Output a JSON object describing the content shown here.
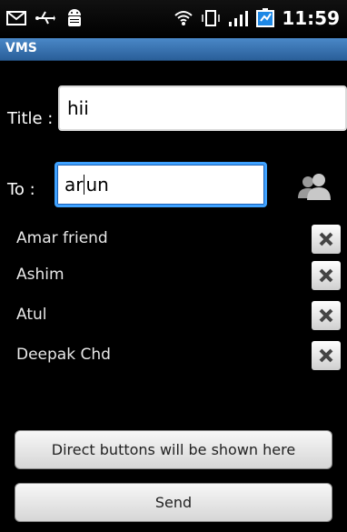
{
  "status_bar": {
    "time": "11:59",
    "icons": [
      "gmail-icon",
      "usb-icon",
      "android-debug-icon",
      "wifi-icon",
      "vibrate-icon",
      "signal-icon",
      "battery-icon"
    ]
  },
  "app": {
    "title": "VMS"
  },
  "form": {
    "title_label": "Title :",
    "title_value": "hii",
    "to_label": "To   :",
    "to_value_before_cursor": "ar",
    "to_value_after_cursor": "un"
  },
  "recipients": [
    {
      "name": "Amar friend"
    },
    {
      "name": "Ashim"
    },
    {
      "name": "Atul"
    },
    {
      "name": "Deepak Chd"
    }
  ],
  "buttons": {
    "direct": "Direct buttons will be shown here",
    "send": "Send"
  },
  "colors": {
    "title_bar": "#3b78b8",
    "focus": "#3fa2ff",
    "background": "#000000"
  }
}
